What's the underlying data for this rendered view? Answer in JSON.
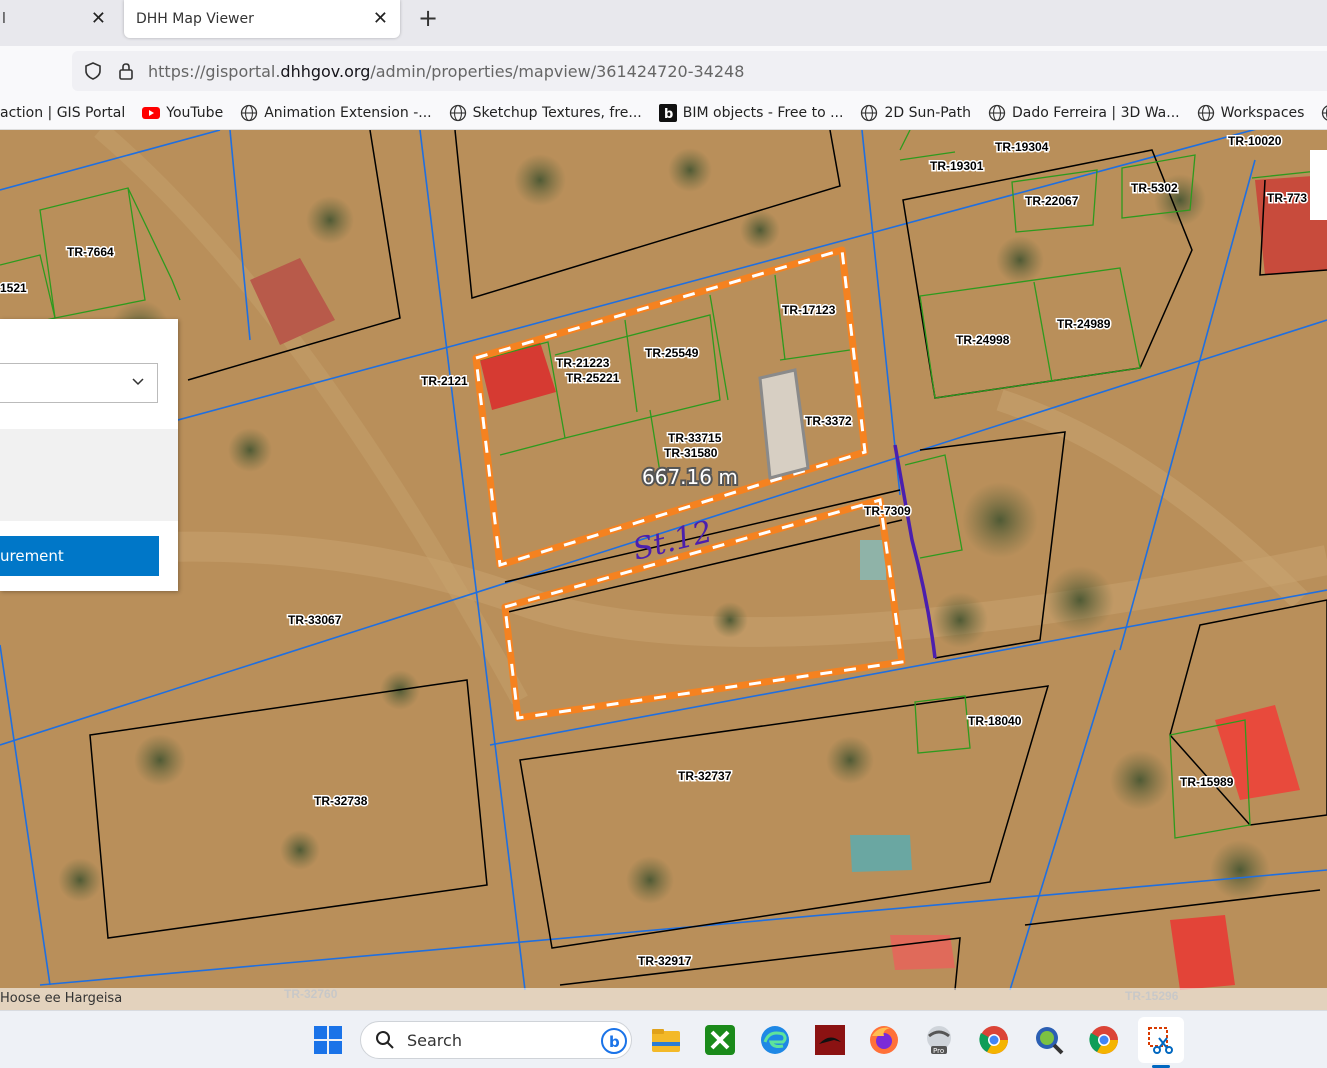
{
  "browser": {
    "inactive_tab_label": "l",
    "active_tab_label": "DHH Map Viewer",
    "close_glyph": "✕",
    "new_tab_glyph": "+",
    "url_prefix": "https://gisportal.",
    "url_domain": "dhhgov.org",
    "url_path": "/admin/properties/mapview/361424720-34248",
    "bookmarks": [
      {
        "label": "action | GIS Portal",
        "icon": "none"
      },
      {
        "label": "YouTube",
        "icon": "youtube-icon"
      },
      {
        "label": "Animation Extension -...",
        "icon": "globe-icon"
      },
      {
        "label": "Sketchup Textures, fre...",
        "icon": "globe-icon"
      },
      {
        "label": "BIM objects - Free to ...",
        "icon": "bim-icon"
      },
      {
        "label": "2D Sun-Path",
        "icon": "globe-icon"
      },
      {
        "label": "Dado Ferreira | 3D Wa...",
        "icon": "globe-icon"
      },
      {
        "label": "Workspaces",
        "icon": "globe-icon"
      },
      {
        "label": "O",
        "icon": "globe-icon"
      }
    ]
  },
  "panel": {
    "dropdown_value": "",
    "button_label": "urement"
  },
  "map": {
    "measurement_label": "667.16 m",
    "annotation_text": "St.12",
    "parcels": [
      {
        "id": "TR-19304"
      },
      {
        "id": "TR-19301"
      },
      {
        "id": "TR-10020"
      },
      {
        "id": "TR-22067"
      },
      {
        "id": "TR-5302"
      },
      {
        "id": "TR-773"
      },
      {
        "id": "TR-7664"
      },
      {
        "id": "1521"
      },
      {
        "id": "TR-17123"
      },
      {
        "id": "TR-24998"
      },
      {
        "id": "TR-24989"
      },
      {
        "id": "TR-21223"
      },
      {
        "id": "TR-25221"
      },
      {
        "id": "TR-25549"
      },
      {
        "id": "TR-2121"
      },
      {
        "id": "TR-3372"
      },
      {
        "id": "TR-33715"
      },
      {
        "id": "TR-31580"
      },
      {
        "id": "TR-7309"
      },
      {
        "id": "TR-33067"
      },
      {
        "id": "TR-18040"
      },
      {
        "id": "TR-32737"
      },
      {
        "id": "TR-32738"
      },
      {
        "id": "TR-15989"
      },
      {
        "id": "TR-32917"
      },
      {
        "id": "TR-32760"
      },
      {
        "id": "TR-15296"
      }
    ],
    "attribution": "Hoose ee Hargeisa"
  },
  "taskbar": {
    "search_label": "Search",
    "apps": [
      "windows-start-icon",
      "file-explorer-icon",
      "xbox-icon",
      "edge-icon",
      "app-red-icon",
      "firefox-icon",
      "pro-app-icon",
      "chrome-icon",
      "qgis-icon",
      "chrome-alt-icon",
      "snipping-tool-icon"
    ]
  },
  "colors": {
    "highlight_orange": "#f58220",
    "parcel_black": "#000000",
    "parcel_green": "#2e9a1e",
    "road_blue": "#1f6fe0",
    "annotation_purple": "#4b1fae",
    "button_blue": "#0077c8"
  }
}
